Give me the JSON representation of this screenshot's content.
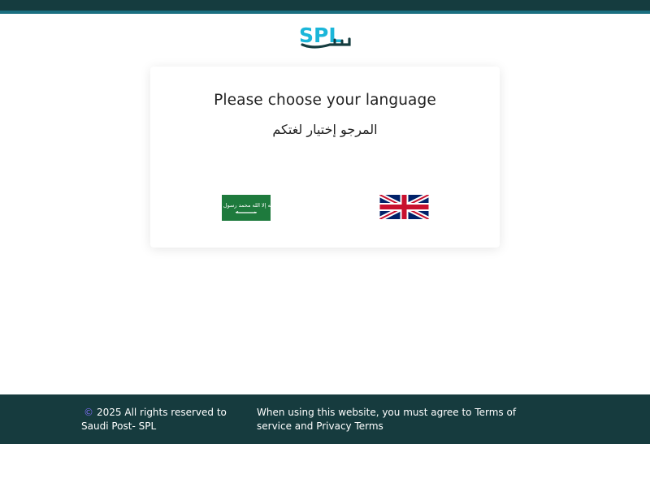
{
  "header": {
    "logo_text": "SPL",
    "logo_icon": "spl-logo"
  },
  "language_card": {
    "title": "Please choose your language",
    "subtitle": "المرجو إختيار لغتكم",
    "options": [
      {
        "language": "Arabic",
        "flag_icon": "saudi-flag-icon",
        "emblem_text": "لا إله إلا الله محمد رسول الله"
      },
      {
        "language": "English",
        "flag_icon": "uk-flag-icon"
      }
    ]
  },
  "footer": {
    "copyright_symbol": "©",
    "copyright_text": "2025 All rights reserved to Saudi Post- SPL",
    "terms_text": "When using this website, you must agree to Terms of service and Privacy Terms"
  },
  "colors": {
    "header_bar": "#153c3f",
    "header_accent": "#1a6f80",
    "footer_bg": "#163b3e",
    "logo_blue": "#1bb6d9",
    "logo_dark": "#153c3f",
    "saudi_green": "#1e7a3d"
  }
}
